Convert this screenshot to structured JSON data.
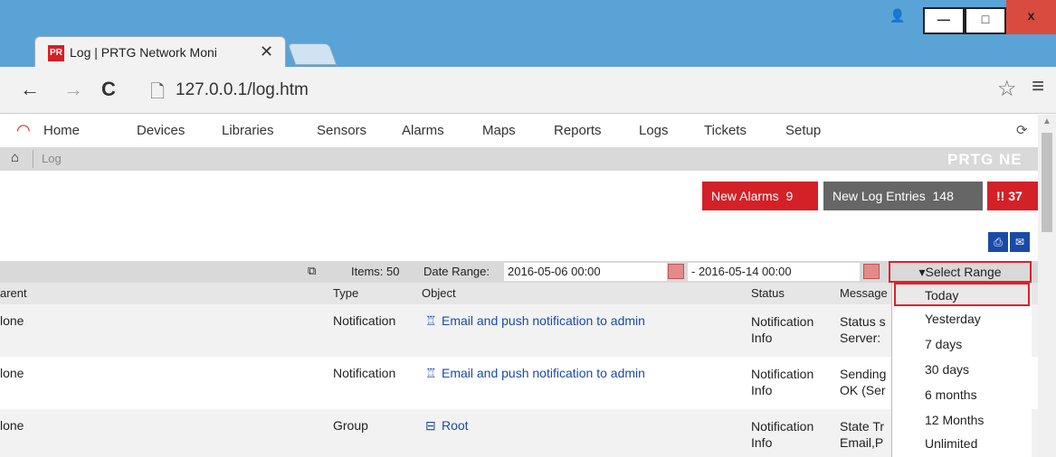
{
  "browser": {
    "tab_title": "Log | PRTG Network Moni",
    "tab_close": "✕",
    "favicon_text": "PR",
    "url": "127.0.0.1/log.htm",
    "window_controls": {
      "user": "👤",
      "minimize": "—",
      "maximize": "□",
      "close": "x"
    }
  },
  "nav": {
    "items": [
      "Home",
      "Devices",
      "Libraries",
      "Sensors",
      "Alarms",
      "Maps",
      "Reports",
      "Logs",
      "Tickets",
      "Setup"
    ]
  },
  "breadcrumb": {
    "current": "Log",
    "brand": "PRTG NE"
  },
  "badges": {
    "alarms_label": "New Alarms",
    "alarms_count": "9",
    "log_label": "New Log Entries",
    "log_count": "148",
    "count_text": "!! 37"
  },
  "toolbar": {
    "items_label": "Items: 50",
    "date_range_label": "Date Range:",
    "date_from": "2016-05-06 00:00",
    "date_to": "- 2016-05-14 00:00",
    "select_range": "▾Select Range"
  },
  "table": {
    "headers": {
      "parent": "arent",
      "type": "Type",
      "object": "Object",
      "status": "Status",
      "message": "Message"
    },
    "rows": [
      {
        "parent": "lone",
        "type": "Notification",
        "object_icon": "♖",
        "object": "Email and push notification to admin",
        "status_1": "Notification",
        "status_2": "Info",
        "msg_1": "Status s",
        "msg_2": "Server:"
      },
      {
        "parent": "lone",
        "type": "Notification",
        "object_icon": "♖",
        "object": "Email and push notification to admin",
        "status_1": "Notification",
        "status_2": "Info",
        "msg_1": "Sending",
        "msg_2": "OK (Ser"
      },
      {
        "parent": "lone",
        "type": "Group",
        "object_icon": "⊟",
        "object": "Root",
        "status_1": "Notification",
        "status_2": "Info",
        "msg_1": "State Tr",
        "msg_2": "Email,P"
      }
    ]
  },
  "dropdown": {
    "options": [
      "Today",
      "Yesterday",
      "7 days",
      "30 days",
      "6 months",
      "12 Months",
      "Unlimited"
    ],
    "selected": "Today"
  },
  "colors": {
    "accent_red": "#d42027",
    "link_blue": "#1a4aa8",
    "chrome_blue": "#5aa3d6"
  }
}
